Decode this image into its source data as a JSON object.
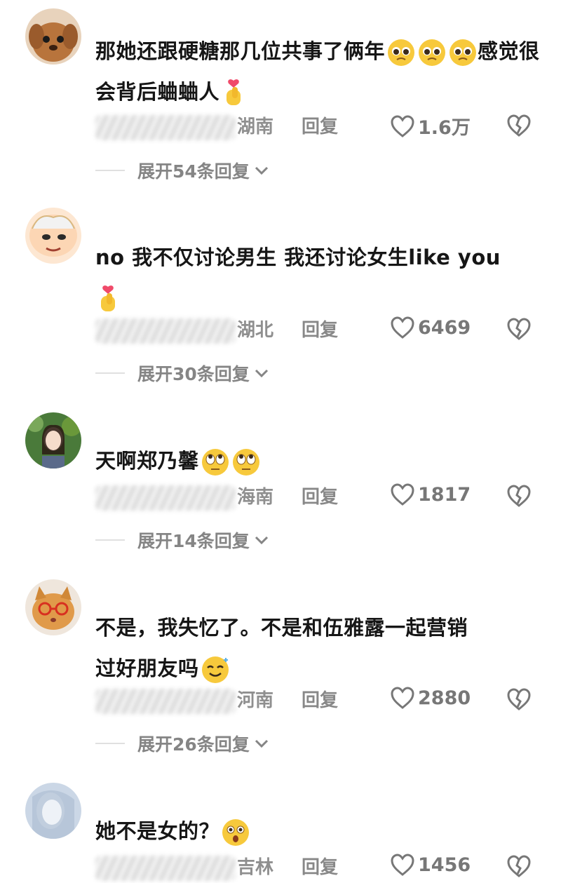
{
  "comments": [
    {
      "text": "那她还跟硬糖那几位共事了俩年",
      "text_cont": "感觉很会背后蛐蛐人",
      "location": "湖南",
      "reply": "回复",
      "likes": "1.6万",
      "expand": "展开54条回复",
      "avatar": "puppy"
    },
    {
      "text": "no 我不仅讨论男生 我还讨论女生like you",
      "location": "湖北",
      "reply": "回复",
      "likes": "6469",
      "expand": "展开30条回复",
      "avatar": "cartoon"
    },
    {
      "text": "天啊郑乃馨",
      "location": "海南",
      "reply": "回复",
      "likes": "1817",
      "expand": "展开14条回复",
      "avatar": "girl-photo"
    },
    {
      "text": "不是，我失忆了。不是和伍雅露一起营销",
      "text_cont": "过好朋友吗",
      "location": "河南",
      "reply": "回复",
      "likes": "2880",
      "expand": "展开26条回复",
      "avatar": "cat-glasses"
    },
    {
      "text": "她不是女的？",
      "location": "吉林",
      "reply": "回复",
      "likes": "1456",
      "avatar": "pale-photo"
    }
  ],
  "colors": {
    "text": "#161616",
    "meta": "#8a8a8a",
    "emoji_face": "#f7c93c"
  },
  "icons": [
    "heart-outline-icon",
    "broken-heart-icon",
    "chevron-down-icon",
    "finger-heart-emoji",
    "pleading-face-emoji",
    "eye-roll-face-emoji",
    "shocked-face-emoji"
  ]
}
